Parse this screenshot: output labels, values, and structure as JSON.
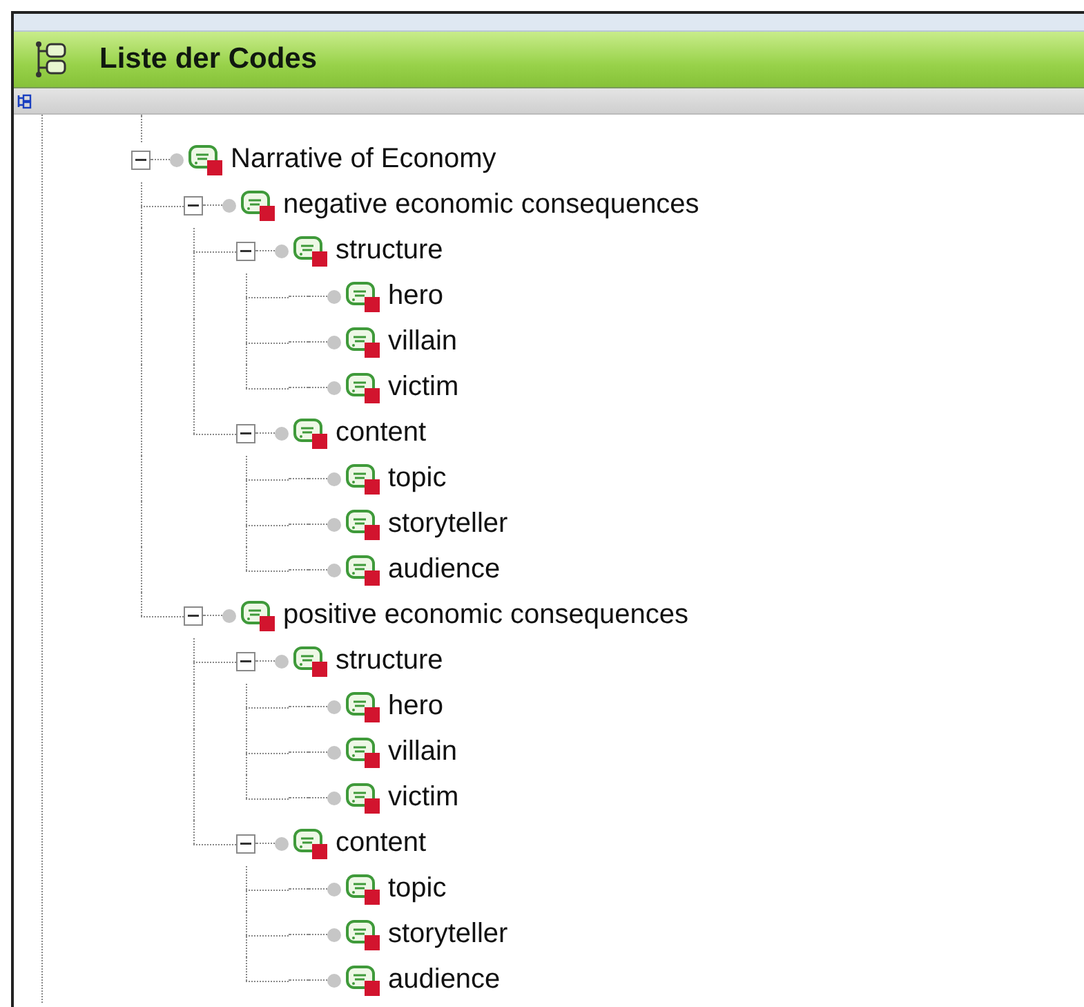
{
  "panel": {
    "title": "Liste der Codes"
  },
  "tree": [
    {
      "label": "Narrative of Economy",
      "expanded": true,
      "children": [
        {
          "label": "negative economic consequences",
          "expanded": true,
          "children": [
            {
              "label": "structure",
              "expanded": true,
              "children": [
                {
                  "label": "hero"
                },
                {
                  "label": "villain"
                },
                {
                  "label": "victim"
                }
              ]
            },
            {
              "label": "content",
              "expanded": true,
              "children": [
                {
                  "label": "topic"
                },
                {
                  "label": "storyteller"
                },
                {
                  "label": "audience"
                }
              ]
            }
          ]
        },
        {
          "label": "positive economic consequences",
          "expanded": true,
          "children": [
            {
              "label": "structure",
              "expanded": true,
              "children": [
                {
                  "label": "hero"
                },
                {
                  "label": "villain"
                },
                {
                  "label": "victim"
                }
              ]
            },
            {
              "label": "content",
              "expanded": true,
              "children": [
                {
                  "label": "topic"
                },
                {
                  "label": "storyteller"
                },
                {
                  "label": "audience"
                }
              ]
            }
          ]
        }
      ]
    }
  ]
}
